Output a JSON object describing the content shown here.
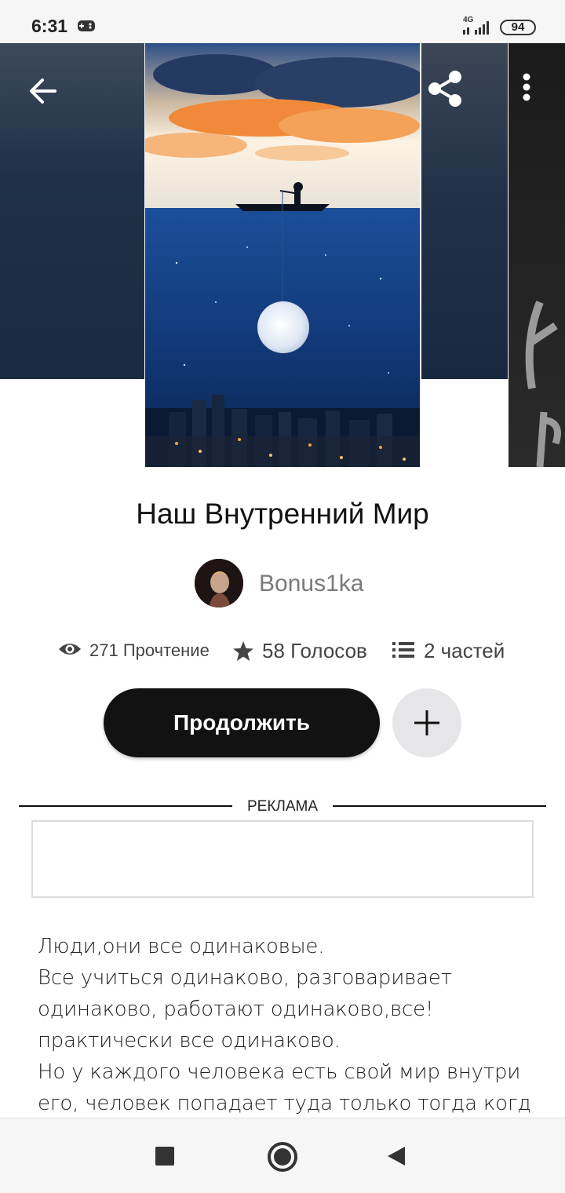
{
  "status_bar": {
    "time": "6:31",
    "network": "4G",
    "battery": "94",
    "icons": [
      "game-controller-icon",
      "signal-icon",
      "battery-icon"
    ]
  },
  "toolbar": {
    "icons": [
      "back-arrow-icon",
      "share-icon",
      "more-vertical-icon"
    ]
  },
  "story": {
    "title": "Наш Внутренний Мир",
    "author": "Bonus1ka",
    "stats": {
      "reads": "271 Прочтение",
      "votes": "58 Голосов",
      "parts": "2 частей"
    },
    "continue_label": "Продолжить",
    "add_icon": "plus-icon"
  },
  "ad": {
    "label": "РЕКЛАМА"
  },
  "description": {
    "lines": [
      "Люди,они все одинаковые.",
      "Все учиться одинаково, разговаривает",
      "одинаково, работают одинаково,все!",
      "практически все одинаково.",
      "Но у каждого человека есть свой мир внутри",
      "его, человек попадает туда только тогда когда"
    ]
  },
  "nav_bar": {
    "icons": [
      "recent-apps-icon",
      "home-icon",
      "back-triangle-icon"
    ]
  },
  "colors": {
    "primary_button": "#121212",
    "add_button": "#e6e6e8",
    "muted_text": "#7a7a7a"
  }
}
